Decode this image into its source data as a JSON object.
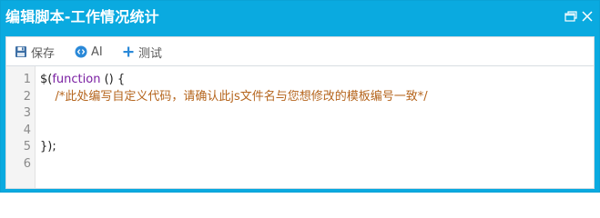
{
  "window": {
    "title": "编辑脚本-工作情况统计",
    "restore_icon": "restore-icon",
    "close_icon": "close-icon",
    "accent_color": "#0aaae0"
  },
  "toolbar": {
    "save_label": "保存",
    "ai_label": "AI",
    "test_label": "测试",
    "save_icon": "floppy-disk-icon",
    "ai_icon": "ai-code-icon",
    "test_icon": "plus-icon"
  },
  "editor": {
    "line_numbers": [
      "1",
      "2",
      "3",
      "4",
      "5",
      "6"
    ],
    "lines": {
      "l1_prefix": "$(",
      "l1_keyword": "function",
      "l1_suffix": " () {",
      "l2_indent": "    ",
      "l2_comment": "/*此处编写自定义代码，请确认此js文件名与您想修改的模板编号一致*/",
      "l3": "",
      "l4": "",
      "l5": "});",
      "l6": ""
    },
    "colors": {
      "keyword": "#7a1fa2",
      "comment": "#b5651d",
      "text": "#222222"
    }
  }
}
